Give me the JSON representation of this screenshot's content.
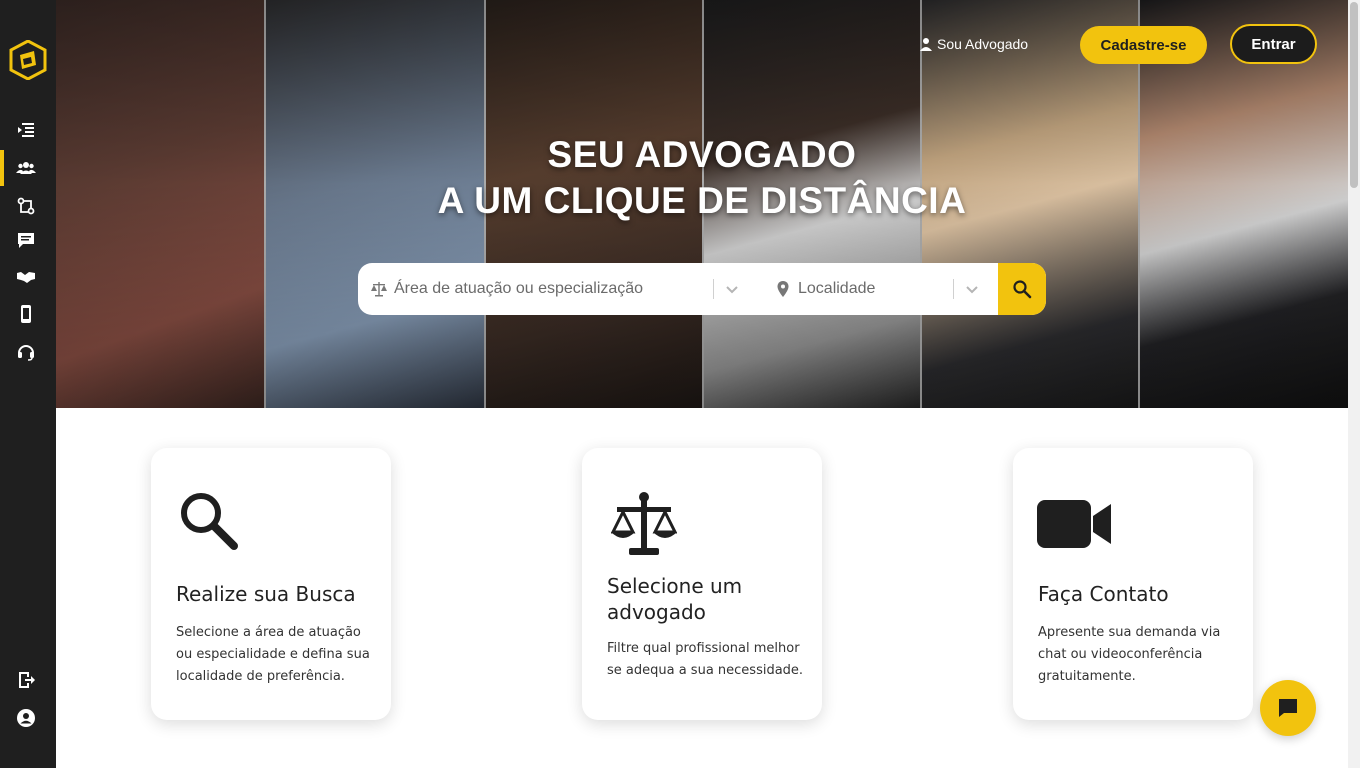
{
  "nav": {
    "lawyer_link": "Sou Advogado",
    "signup": "Cadastre-se",
    "login": "Entrar"
  },
  "hero": {
    "title_line1": "SEU ADVOGADO",
    "title_line2": "A UM CLIQUE DE DISTÂNCIA"
  },
  "search": {
    "area_placeholder": "Área de atuação ou especialização",
    "location_placeholder": "Localidade"
  },
  "cards": [
    {
      "title": "Realize sua Busca",
      "text": "Selecione a área de atuação ou especialidade e defina sua localidade de preferência.",
      "icon": "magnifier-icon"
    },
    {
      "title": "Selecione um advogado",
      "text": "Filtre qual profissional melhor se adequa a sua necessidade.",
      "icon": "scales-icon"
    },
    {
      "title": "Faça Contato",
      "text": "Apresente sua demanda via chat ou videoconferência gratuitamente.",
      "icon": "video-camera-icon"
    }
  ],
  "sidebar": {
    "icons": [
      "menu-icon",
      "users-icon",
      "route-icon",
      "message-icon",
      "handshake-icon",
      "mobile-icon",
      "headset-icon",
      "exit-icon",
      "user-circle-icon"
    ]
  },
  "colors": {
    "accent": "#f2c30e",
    "sidebar": "#1f1f1f"
  }
}
